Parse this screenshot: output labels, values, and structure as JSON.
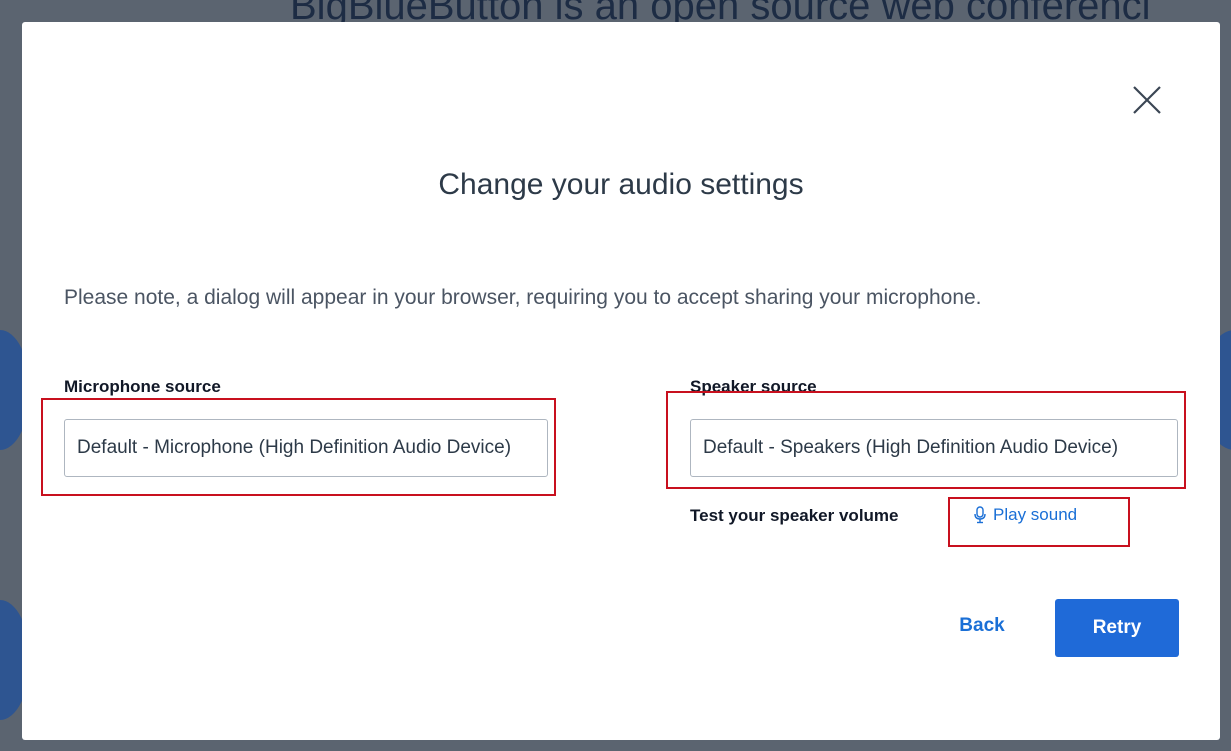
{
  "background": {
    "partial_text": "BigBlueButton is an open source web conferenci"
  },
  "dialog": {
    "title": "Change your audio settings",
    "note": "Please note, a dialog will appear in your browser, requiring you to accept sharing your microphone.",
    "close_icon": "close-icon",
    "microphone": {
      "label": "Microphone source",
      "selected": "Default - Microphone (High Definition Audio Device)"
    },
    "speaker": {
      "label": "Speaker source",
      "selected": "Default - Speakers (High Definition Audio Device)"
    },
    "test": {
      "label": "Test your speaker volume",
      "play_label": "Play sound",
      "play_icon": "microphone-icon"
    },
    "buttons": {
      "back_label": "Back",
      "retry_label": "Retry"
    }
  },
  "colors": {
    "primary": "#1f6ad8",
    "link": "#1a6fd6",
    "highlight": "#c8101e",
    "overlay": "#5b6470"
  }
}
